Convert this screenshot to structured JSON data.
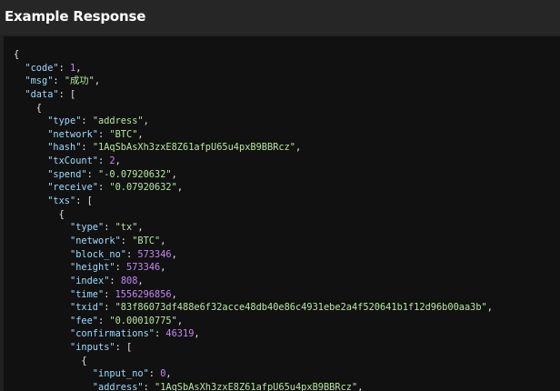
{
  "header": {
    "title": "Example Response"
  },
  "code_lines": [
    [
      [
        "p",
        "{"
      ]
    ],
    [
      [
        "p",
        "  "
      ],
      [
        "k",
        "\"code\""
      ],
      [
        "p",
        ": "
      ],
      [
        "n",
        "1"
      ],
      [
        "p",
        ","
      ]
    ],
    [
      [
        "p",
        "  "
      ],
      [
        "k",
        "\"msg\""
      ],
      [
        "p",
        ": "
      ],
      [
        "s",
        "\"成功\""
      ],
      [
        "p",
        ","
      ]
    ],
    [
      [
        "p",
        "  "
      ],
      [
        "k",
        "\"data\""
      ],
      [
        "p",
        ": ["
      ]
    ],
    [
      [
        "p",
        "    {"
      ]
    ],
    [
      [
        "p",
        "      "
      ],
      [
        "k",
        "\"type\""
      ],
      [
        "p",
        ": "
      ],
      [
        "s",
        "\"address\""
      ],
      [
        "p",
        ","
      ]
    ],
    [
      [
        "p",
        "      "
      ],
      [
        "k",
        "\"network\""
      ],
      [
        "p",
        ": "
      ],
      [
        "s",
        "\"BTC\""
      ],
      [
        "p",
        ","
      ]
    ],
    [
      [
        "p",
        "      "
      ],
      [
        "k",
        "\"hash\""
      ],
      [
        "p",
        ": "
      ],
      [
        "s",
        "\"1AqSbAsXh3zxE8Z61afpU65u4pxB9BBRcz\""
      ],
      [
        "p",
        ","
      ]
    ],
    [
      [
        "p",
        "      "
      ],
      [
        "k",
        "\"txCount\""
      ],
      [
        "p",
        ": "
      ],
      [
        "n",
        "2"
      ],
      [
        "p",
        ","
      ]
    ],
    [
      [
        "p",
        "      "
      ],
      [
        "k",
        "\"spend\""
      ],
      [
        "p",
        ": "
      ],
      [
        "s",
        "\"-0.07920632\""
      ],
      [
        "p",
        ","
      ]
    ],
    [
      [
        "p",
        "      "
      ],
      [
        "k",
        "\"receive\""
      ],
      [
        "p",
        ": "
      ],
      [
        "s",
        "\"0.07920632\""
      ],
      [
        "p",
        ","
      ]
    ],
    [
      [
        "p",
        "      "
      ],
      [
        "k",
        "\"txs\""
      ],
      [
        "p",
        ": ["
      ]
    ],
    [
      [
        "p",
        "        {"
      ]
    ],
    [
      [
        "p",
        "          "
      ],
      [
        "k",
        "\"type\""
      ],
      [
        "p",
        ": "
      ],
      [
        "s",
        "\"tx\""
      ],
      [
        "p",
        ","
      ]
    ],
    [
      [
        "p",
        "          "
      ],
      [
        "k",
        "\"network\""
      ],
      [
        "p",
        ": "
      ],
      [
        "s",
        "\"BTC\""
      ],
      [
        "p",
        ","
      ]
    ],
    [
      [
        "p",
        "          "
      ],
      [
        "k",
        "\"block_no\""
      ],
      [
        "p",
        ": "
      ],
      [
        "n",
        "573346"
      ],
      [
        "p",
        ","
      ]
    ],
    [
      [
        "p",
        "          "
      ],
      [
        "k",
        "\"height\""
      ],
      [
        "p",
        ": "
      ],
      [
        "n",
        "573346"
      ],
      [
        "p",
        ","
      ]
    ],
    [
      [
        "p",
        "          "
      ],
      [
        "k",
        "\"index\""
      ],
      [
        "p",
        ": "
      ],
      [
        "n",
        "808"
      ],
      [
        "p",
        ","
      ]
    ],
    [
      [
        "p",
        "          "
      ],
      [
        "k",
        "\"time\""
      ],
      [
        "p",
        ": "
      ],
      [
        "n",
        "1556296856"
      ],
      [
        "p",
        ","
      ]
    ],
    [
      [
        "p",
        "          "
      ],
      [
        "k",
        "\"txid\""
      ],
      [
        "p",
        ": "
      ],
      [
        "s",
        "\"83f86073df488e6f32acce48db40e86c4931ebe2a4f520641b1f12d96b00aa3b\""
      ],
      [
        "p",
        ","
      ]
    ],
    [
      [
        "p",
        "          "
      ],
      [
        "k",
        "\"fee\""
      ],
      [
        "p",
        ": "
      ],
      [
        "s",
        "\"0.00010775\""
      ],
      [
        "p",
        ","
      ]
    ],
    [
      [
        "p",
        "          "
      ],
      [
        "k",
        "\"confirmations\""
      ],
      [
        "p",
        ": "
      ],
      [
        "n",
        "46319"
      ],
      [
        "p",
        ","
      ]
    ],
    [
      [
        "p",
        "          "
      ],
      [
        "k",
        "\"inputs\""
      ],
      [
        "p",
        ": ["
      ]
    ],
    [
      [
        "p",
        "            {"
      ]
    ],
    [
      [
        "p",
        "              "
      ],
      [
        "k",
        "\"input_no\""
      ],
      [
        "p",
        ": "
      ],
      [
        "n",
        "0"
      ],
      [
        "p",
        ","
      ]
    ],
    [
      [
        "p",
        "              "
      ],
      [
        "k",
        "\"address\""
      ],
      [
        "p",
        ": "
      ],
      [
        "s",
        "\"1AqSbAsXh3zxE8Z61afpU65u4pxB9BBRcz\""
      ],
      [
        "p",
        ","
      ]
    ]
  ]
}
